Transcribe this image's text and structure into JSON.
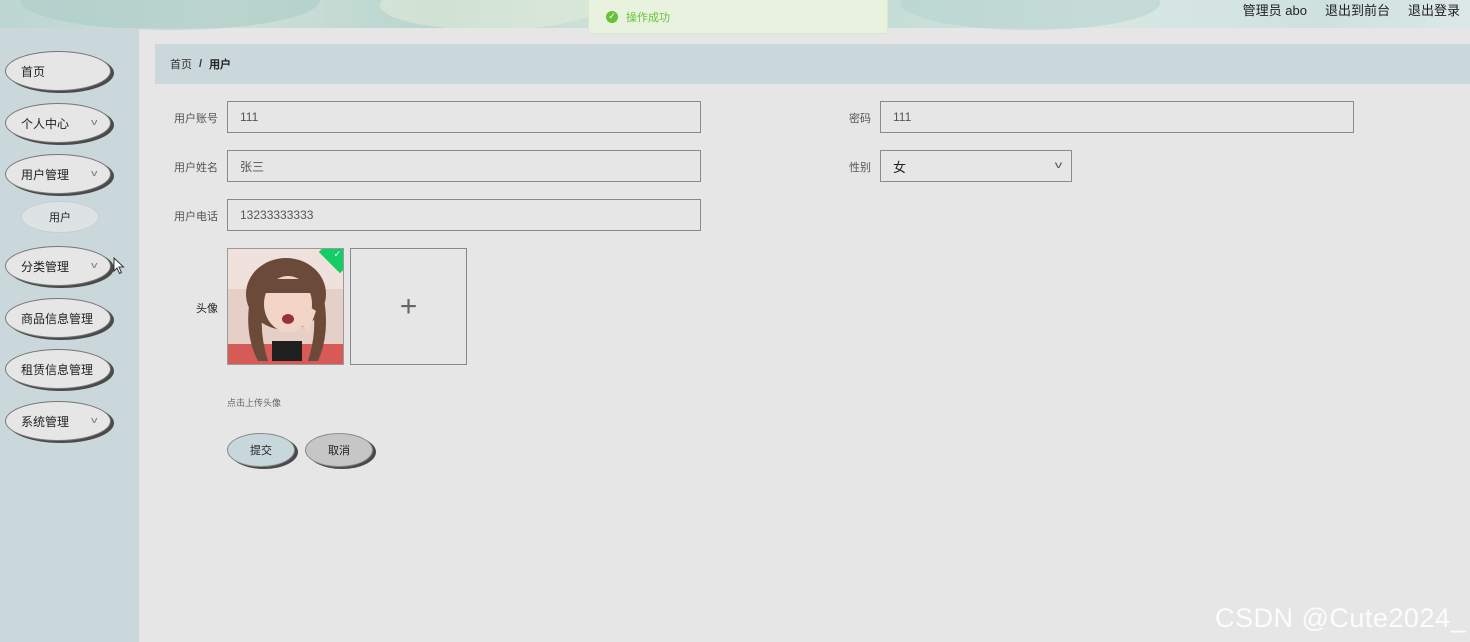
{
  "header": {
    "user_label": "管理员 abo",
    "to_front_label": "退出到前台",
    "logout_label": "退出登录"
  },
  "toast": {
    "message": "操作成功",
    "type": "success"
  },
  "sidebar": {
    "items": [
      {
        "label": "首页",
        "has_arrow": false
      },
      {
        "label": "个人中心",
        "has_arrow": true
      },
      {
        "label": "用户管理",
        "has_arrow": true,
        "expanded": true,
        "children": [
          {
            "label": "用户"
          }
        ]
      },
      {
        "label": "分类管理",
        "has_arrow": true
      },
      {
        "label": "商品信息管理",
        "has_arrow": false
      },
      {
        "label": "租赁信息管理",
        "has_arrow": false
      },
      {
        "label": "系统管理",
        "has_arrow": true
      }
    ]
  },
  "breadcrumb": {
    "home": "首页",
    "separator": "/",
    "current": "用户"
  },
  "form": {
    "account": {
      "label": "用户账号",
      "value": "111"
    },
    "password": {
      "label": "密码",
      "value": "111"
    },
    "name": {
      "label": "用户姓名",
      "value": "张三"
    },
    "gender": {
      "label": "性别",
      "value": "女"
    },
    "phone": {
      "label": "用户电话",
      "value": "13233333333"
    },
    "avatar": {
      "label": "头像",
      "hint": "点击上传头像",
      "add_symbol": "+"
    },
    "submit_label": "提交",
    "cancel_label": "取消"
  },
  "watermark": "CSDN @Cute2024_",
  "colors": {
    "sidebar_bg": "#cad7db",
    "page_bg": "#e6e6e6",
    "success": "#67c23a",
    "upload_ok": "#13ce66"
  }
}
